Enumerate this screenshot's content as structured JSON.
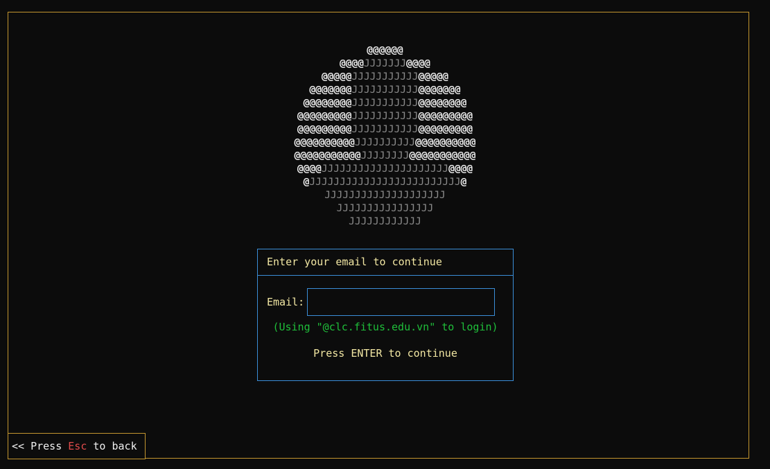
{
  "logo": {
    "lines": [
      [
        [
          "at",
          "@@@@@@"
        ]
      ],
      [
        [
          "at",
          "@@@@"
        ],
        [
          "j",
          "JJJJJJJ"
        ],
        [
          "at",
          "@@@@"
        ]
      ],
      [
        [
          "at",
          "@@@@@"
        ],
        [
          "j",
          "JJJJJJJJJJJ"
        ],
        [
          "at",
          "@@@@@"
        ]
      ],
      [
        [
          "at",
          "@@@@@@@"
        ],
        [
          "j",
          "JJJJJJJJJJJ"
        ],
        [
          "at",
          "@@@@@@@"
        ]
      ],
      [
        [
          "at",
          "@@@@@@@@"
        ],
        [
          "j",
          "JJJJJJJJJJJ"
        ],
        [
          "at",
          "@@@@@@@@"
        ]
      ],
      [
        [
          "at",
          "@@@@@@@@@"
        ],
        [
          "j",
          "JJJJJJJJJJJ"
        ],
        [
          "at",
          "@@@@@@@@@"
        ]
      ],
      [
        [
          "at",
          "@@@@@@@@@"
        ],
        [
          "j",
          "JJJJJJJJJJJ"
        ],
        [
          "at",
          "@@@@@@@@@"
        ]
      ],
      [
        [
          "at",
          "@@@@@@@@@@"
        ],
        [
          "j",
          "JJJJJJJJJJ"
        ],
        [
          "at",
          "@@@@@@@@@@"
        ]
      ],
      [
        [
          "at",
          "@@@@@@@@@@@"
        ],
        [
          "j",
          "JJJJJJJJ"
        ],
        [
          "at",
          "@@@@@@@@@@@"
        ]
      ],
      [
        [
          "at",
          "@@@@"
        ],
        [
          "j",
          "JJJJJJJJJJJJJJJJJJJJJ"
        ],
        [
          "at",
          "@@@@"
        ]
      ],
      [
        [
          "at",
          "@"
        ],
        [
          "j",
          "JJJJJJJJJJJJJJJJJJJJJJJJJ"
        ],
        [
          "at",
          "@"
        ]
      ],
      [
        [
          "j",
          "JJJJJJJJJJJJJJJJJJJJ"
        ]
      ],
      [
        [
          "j",
          "JJJJJJJJJJJJJJJJ"
        ]
      ],
      [
        [
          "j",
          "JJJJJJJJJJJJ"
        ]
      ]
    ]
  },
  "dialog": {
    "title": "Enter your email to continue",
    "email_label": "Email:",
    "email_value": "",
    "email_placeholder": "",
    "hint": "(Using \"@clc.fitus.edu.vn\" to login)",
    "enter_hint": "Press ENTER to continue"
  },
  "back": {
    "prefix": "<< Press ",
    "key": "Esc",
    "suffix": " to back"
  },
  "colors": {
    "frame": "#c4962f",
    "dialog_border": "#3b8ed8",
    "label": "#f2e7a3",
    "hint": "#1fbf3a",
    "key": "#e04b4b",
    "background": "#0c0c0c"
  }
}
